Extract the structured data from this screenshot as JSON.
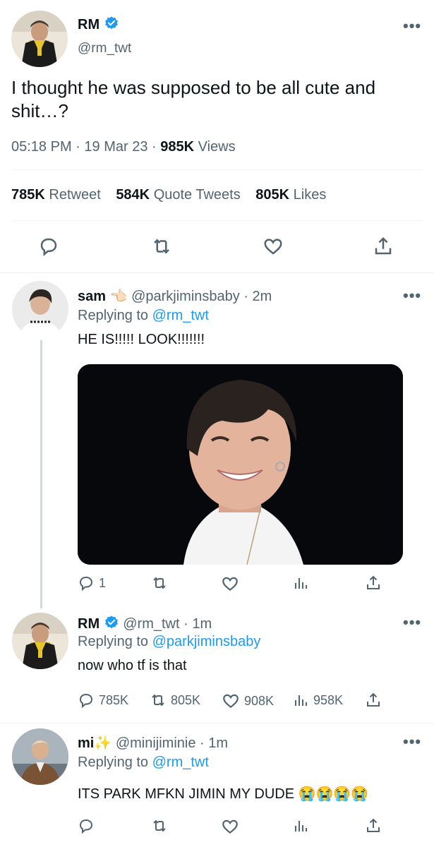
{
  "main_tweet": {
    "name": "RM",
    "handle": "@rm_twt",
    "text": "I thought he was supposed to be all cute and shit…?",
    "time": "05:18 PM",
    "date": "19 Mar 23",
    "views_count": "985K",
    "views_label": "Views",
    "retweets_count": "785K",
    "retweets_label": "Retweet",
    "quotes_count": "584K",
    "quotes_label": "Quote Tweets",
    "likes_count": "805K",
    "likes_label": "Likes",
    "more_icon": "more-dots-icon",
    "action_icons": [
      "reply-icon",
      "retweet-icon",
      "like-icon",
      "share-icon"
    ]
  },
  "replies": [
    {
      "name": "sam",
      "name_emoji": "👈🏻",
      "handle": "@parkjiminsbaby",
      "age": "· 2m",
      "replying_prefix": "Replying to",
      "replying_to": "@rm_twt",
      "text": "HE IS!!!!! LOOK!!!!!!!",
      "has_image": true,
      "reply_count": "1",
      "retweet_count": "",
      "like_count": "",
      "views_count": ""
    },
    {
      "name": "RM",
      "handle": "@rm_twt",
      "age": "· 1m",
      "replying_prefix": "Replying to",
      "replying_to": "@parkjiminsbaby",
      "text": "now who tf is that",
      "reply_count": "785K",
      "retweet_count": "805K",
      "like_count": "908K",
      "views_count": "958K"
    },
    {
      "name": "mi",
      "name_emoji": "✨",
      "handle": "@minijiminie",
      "age": "· 1m",
      "replying_prefix": "Replying to",
      "replying_to": "@rm_twt",
      "text": "ITS PARK MFKN JIMIN MY DUDE 😭😭😭😭"
    }
  ],
  "colors": {
    "accent": "#1d9bf0",
    "text": "#0f1419",
    "secondary": "#536471",
    "divider": "#eff3f4"
  }
}
